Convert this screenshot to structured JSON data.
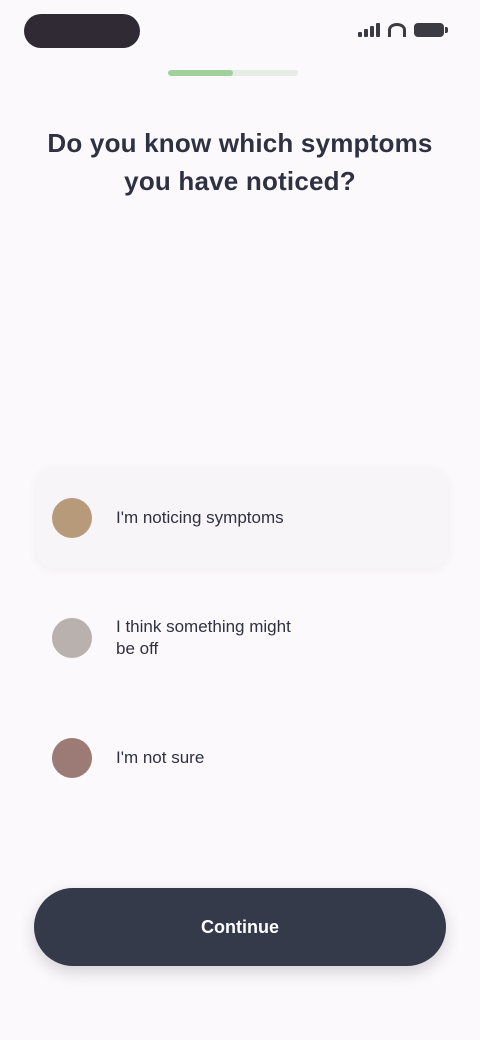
{
  "status_bar": {
    "icons": [
      "signal-icon",
      "wifi-icon",
      "battery-icon"
    ]
  },
  "onboarding": {
    "progress": 0.5,
    "title": "Do you know which symptoms you have noticed?",
    "options": [
      {
        "label": "I'm noticing symptoms",
        "icon": "face-icon",
        "color": "#b79a7a",
        "selected": true
      },
      {
        "label": "I think something might be off",
        "icon": "face-icon",
        "color": "#b8b1ad",
        "selected": false
      },
      {
        "label": "I'm not sure",
        "icon": "face-icon",
        "color": "#9c7a76",
        "selected": false
      }
    ],
    "continue_label": "Continue"
  },
  "colors": {
    "background": "#fcf9fc",
    "accent_progress": "#9fd19a",
    "button": "#353a4a",
    "text": "#2e3142"
  }
}
